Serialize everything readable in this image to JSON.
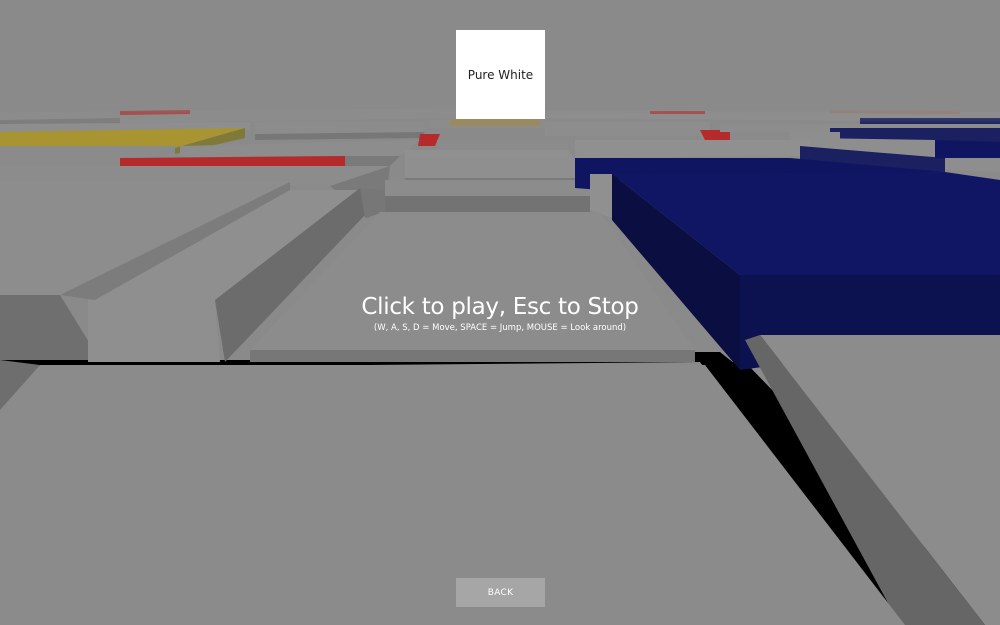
{
  "color_card": {
    "label": "Pure White",
    "color": "#ffffff"
  },
  "overlay": {
    "title": "Click to play, Esc to Stop",
    "controls": "(W, A, S, D = Move, SPACE = Jump, MOUSE = Look around)"
  },
  "back_button": {
    "label": "BACK"
  },
  "palette": {
    "sky": "#8a8a8a",
    "block_top": "#8c8c8c",
    "block_side": "#737373",
    "block_dark": "#5e5e5e",
    "gap": "#000000",
    "blue_top": "#0f1560",
    "blue_side": "#0a0e40",
    "red": "#b52a2a",
    "yellow": "#a89431"
  }
}
